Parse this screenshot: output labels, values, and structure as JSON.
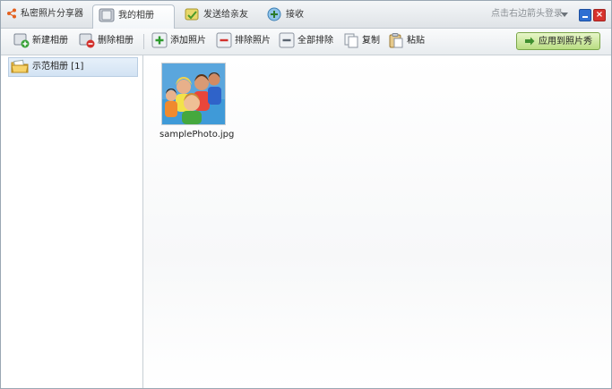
{
  "app": {
    "title": "私密照片分享器"
  },
  "tabs": [
    {
      "label": "我的相册",
      "active": true
    },
    {
      "label": "发送给亲友",
      "active": false
    },
    {
      "label": "接收",
      "active": false
    }
  ],
  "header": {
    "login_text": "点击右边箭头登录"
  },
  "toolbar": {
    "new_album": "新建相册",
    "delete_album": "删除相册",
    "add_photo": "添加照片",
    "remove_photo": "排除照片",
    "remove_all": "全部排除",
    "copy": "复制",
    "paste": "粘贴",
    "apply": "应用到照片秀"
  },
  "sidebar": {
    "albums": [
      {
        "label": "示范相册 [1]"
      }
    ]
  },
  "main": {
    "photos": [
      {
        "name": "samplePhoto.jpg"
      }
    ]
  },
  "colors": {
    "accent_green": "#b9dd82",
    "selection_blue": "#d3e3f3",
    "close_red": "#d7322d"
  }
}
